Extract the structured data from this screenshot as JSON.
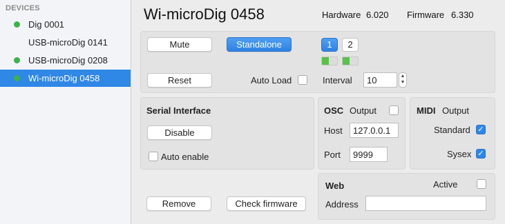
{
  "sidebar": {
    "heading": "DEVICES",
    "items": [
      {
        "label": "Dig 0001",
        "status": "connected"
      },
      {
        "label": "USB-microDig 0141",
        "status": "none"
      },
      {
        "label": "USB-microDig 0208",
        "status": "connected"
      },
      {
        "label": "Wi-microDig 0458",
        "status": "connected",
        "selected": true
      }
    ]
  },
  "header": {
    "title": "Wi-microDig 0458",
    "hardware_label": "Hardware",
    "hardware_value": "6.020",
    "firmware_label": "Firmware",
    "firmware_value": "6.330"
  },
  "controls": {
    "mute_label": "Mute",
    "standalone_label": "Standalone",
    "channel_1": "1",
    "channel_2": "2",
    "reset_label": "Reset",
    "auto_load_label": "Auto Load",
    "interval_label": "Interval",
    "interval_value": "10"
  },
  "serial": {
    "title": "Serial Interface",
    "disable_label": "Disable",
    "auto_enable_label": "Auto enable"
  },
  "osc": {
    "title": "OSC",
    "output_label": "Output",
    "host_label": "Host",
    "host_value": "127.0.0.1",
    "port_label": "Port",
    "port_value": "9999"
  },
  "midi": {
    "title": "MIDI",
    "output_label": "Output",
    "standard_label": "Standard",
    "sysex_label": "Sysex"
  },
  "bottom": {
    "remove_label": "Remove",
    "check_firmware_label": "Check firmware"
  },
  "web": {
    "title": "Web",
    "active_label": "Active",
    "address_label": "Address",
    "address_value": ""
  },
  "colors": {
    "accent": "#2f87e6",
    "status_green": "#3bb34a"
  }
}
